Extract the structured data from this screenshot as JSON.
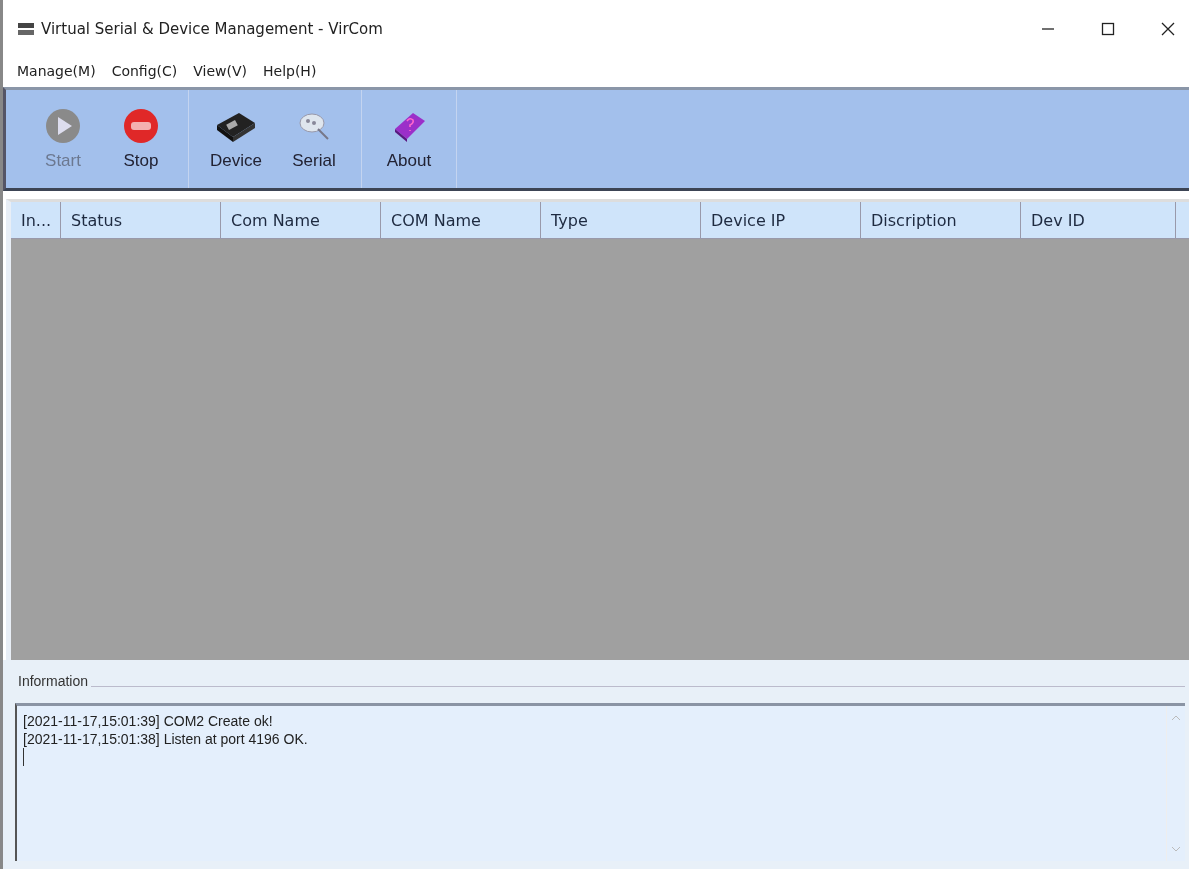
{
  "window": {
    "title": "Virtual Serial & Device Management - VirCom"
  },
  "menu": [
    "Manage(M)",
    "Config(C)",
    "View(V)",
    "Help(H)"
  ],
  "toolbar": [
    [
      {
        "label": "Start",
        "kind": "start",
        "disabled": true
      },
      {
        "label": "Stop",
        "kind": "stop",
        "disabled": false
      }
    ],
    [
      {
        "label": "Device",
        "kind": "device",
        "disabled": false
      },
      {
        "label": "Serial",
        "kind": "serial",
        "disabled": false
      }
    ],
    [
      {
        "label": "About",
        "kind": "about",
        "disabled": false
      }
    ]
  ],
  "table": {
    "columns": [
      "In...",
      "Status",
      "Com Name",
      "COM Name",
      "Type",
      "Device IP",
      "Discription",
      "Dev ID"
    ]
  },
  "information": {
    "title": "Information",
    "lines": [
      "[2021-11-17,15:01:39] COM2 Create ok!",
      "[2021-11-17,15:01:38] Listen at port 4196 OK."
    ]
  }
}
